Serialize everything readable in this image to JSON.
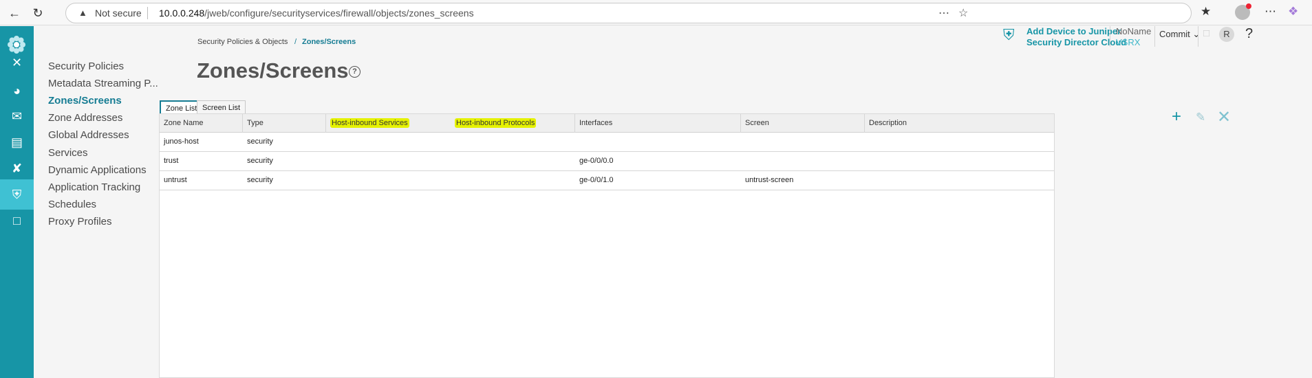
{
  "browser": {
    "security_label": "Not secure",
    "url_host": "10.0.0.248",
    "url_path": "/jweb/configure/securityservices/firewall/objects/zones_screens"
  },
  "header": {
    "breadcrumb": [
      "Security Policies & Objects",
      "Zones/Screens"
    ],
    "breadcrumb_sep": "/",
    "title": "Zones/Screens",
    "help_icon": "?",
    "jsdc_line1": "Add Device to Juniper",
    "jsdc_line2": "Security Director Cloud",
    "device_name": "NoName",
    "device_model": "VSRX",
    "commit_label": "Commit",
    "user_initial": "R",
    "help_label": "?"
  },
  "subnav": {
    "items": [
      {
        "label": "Security Policies"
      },
      {
        "label": "Metadata Streaming P..."
      },
      {
        "label": "Zones/Screens",
        "active": true
      },
      {
        "label": "Zone Addresses"
      },
      {
        "label": "Global Addresses"
      },
      {
        "label": "Services"
      },
      {
        "label": "Dynamic Applications"
      },
      {
        "label": "Application Tracking"
      },
      {
        "label": "Schedules"
      },
      {
        "label": "Proxy Profiles"
      }
    ]
  },
  "tabs": [
    {
      "label": "Zone List",
      "active": true
    },
    {
      "label": "Screen List",
      "active": false
    }
  ],
  "table": {
    "columns": [
      "Zone Name",
      "Type",
      "Host-inbound Services",
      "Host-inbound Protocols",
      "Interfaces",
      "Screen",
      "Description"
    ],
    "highlighted_columns": [
      "Host-inbound Services",
      "Host-inbound Protocols"
    ],
    "rows": [
      [
        "junos-host",
        "security",
        "",
        "",
        "",
        "",
        ""
      ],
      [
        "trust",
        "security",
        "",
        "",
        "ge-0/0/0.0",
        "",
        ""
      ],
      [
        "untrust",
        "security",
        "",
        "",
        "ge-0/0/1.0",
        "untrust-screen",
        ""
      ]
    ]
  },
  "colors": {
    "rail": "#1795a6",
    "rail_active": "#3fc1d3",
    "accent": "#157c93",
    "highlight": "#e5f200"
  },
  "icons": {
    "back": "arrow-left-icon",
    "reload": "reload-icon",
    "add": "plus-icon",
    "edit": "pencil-icon",
    "delete": "close-icon"
  }
}
